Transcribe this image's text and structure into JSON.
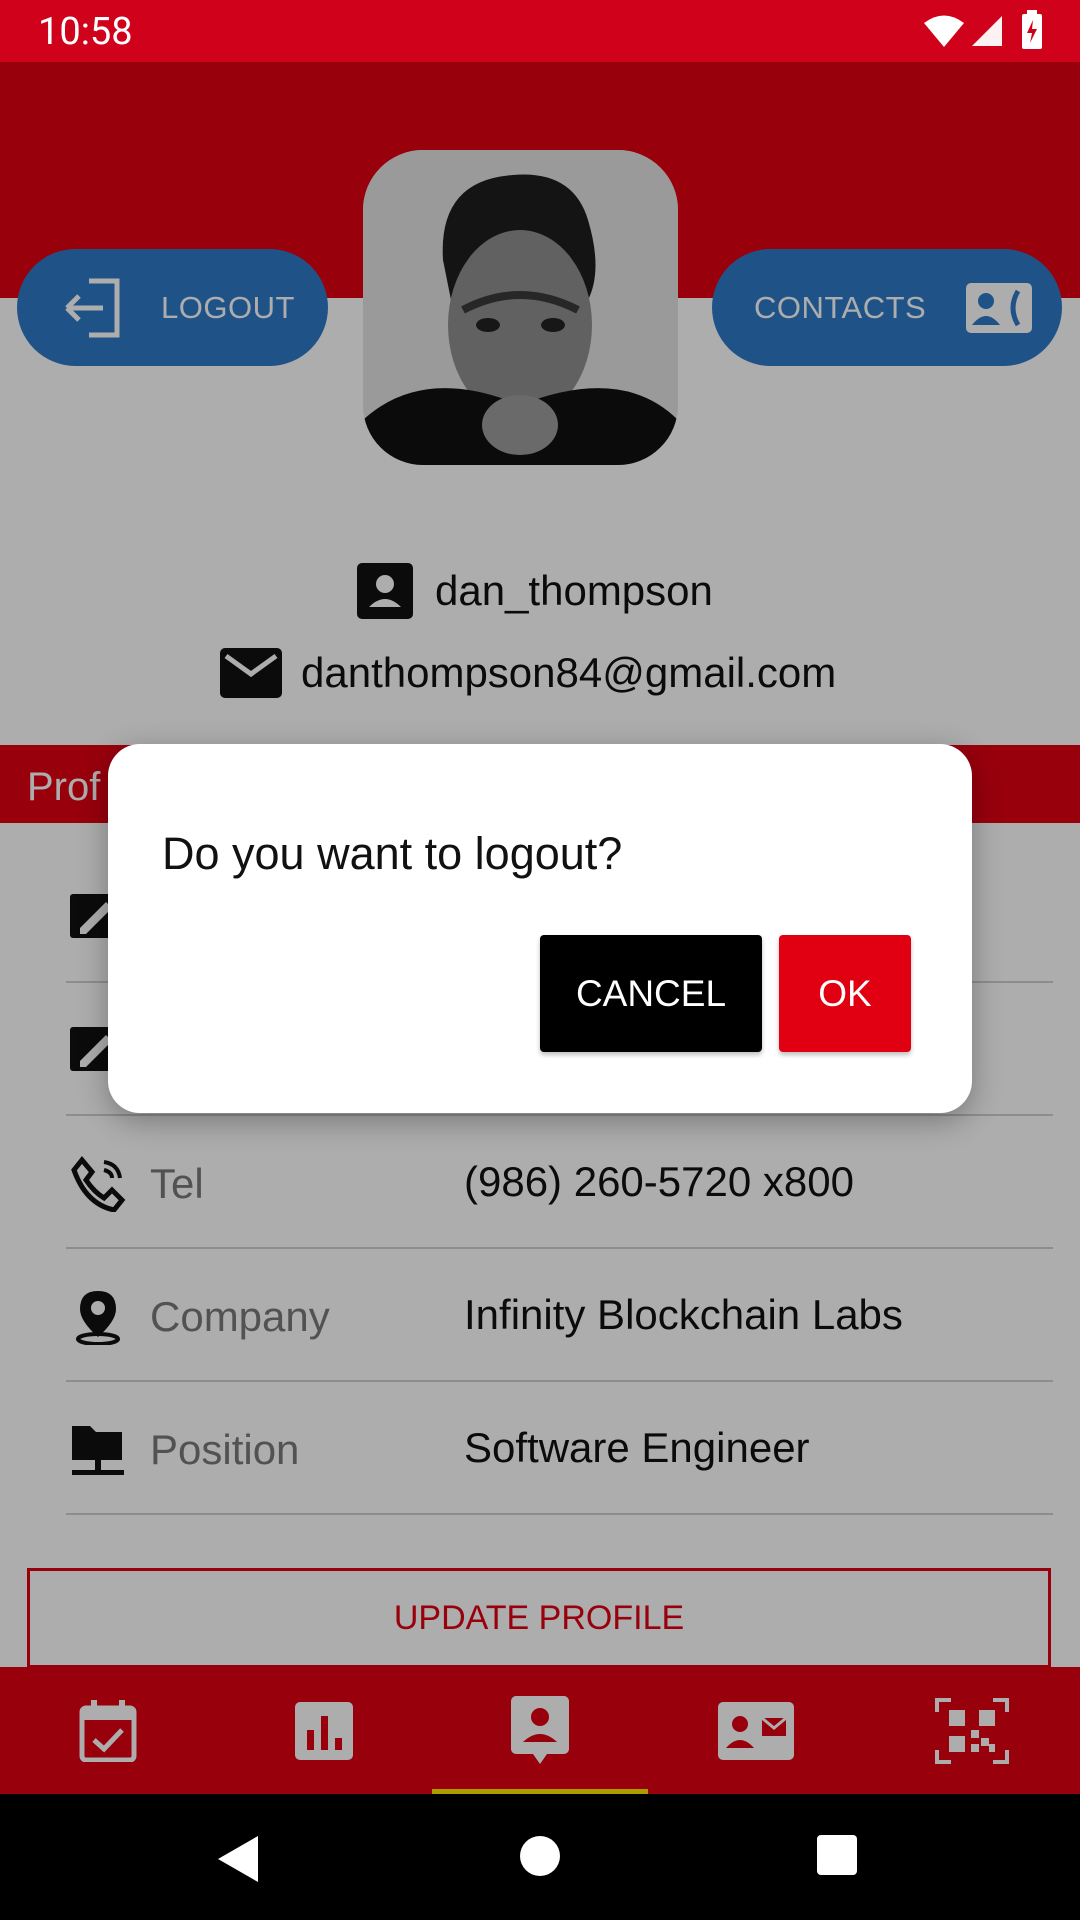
{
  "status_bar": {
    "time": "10:58"
  },
  "header": {
    "logout_label": "LOGOUT",
    "contacts_label": "CONTACTS"
  },
  "user": {
    "username": "dan_thompson",
    "email": "danthompson84@gmail.com"
  },
  "section_label": "Prof",
  "profile_rows": [
    {
      "label": "Tel",
      "value": "(986) 260-5720 x800",
      "icon": "phone-icon"
    },
    {
      "label": "Company",
      "value": "Infinity Blockchain Labs",
      "icon": "location-pin-icon"
    },
    {
      "label": "Position",
      "value": "Software Engineer",
      "icon": "network-folder-icon"
    }
  ],
  "update_profile_label": "UPDATE PROFILE",
  "bottom_nav": {
    "items": [
      "calendar-check-icon",
      "bar-chart-icon",
      "profile-icon",
      "contact-card-icon",
      "qr-code-icon"
    ],
    "selected_index": 2
  },
  "dialog": {
    "message": "Do you want to logout?",
    "cancel_label": "CANCEL",
    "ok_label": "OK"
  },
  "colors": {
    "primary": "#e00012",
    "status_bar": "#d0021b",
    "pill": "#2f7bc9",
    "indicator": "#ffe600"
  }
}
